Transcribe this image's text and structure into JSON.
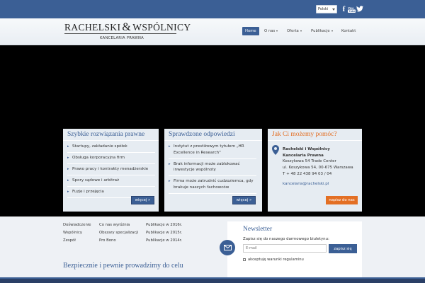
{
  "topbar": {
    "language": "Polski",
    "social": [
      "facebook-icon",
      "youtube-icon",
      "twitter-icon"
    ]
  },
  "header": {
    "logo_left": "RACHELSKI",
    "logo_amp": "&",
    "logo_right": "WSPÓLNICY",
    "logo_sub": "KANCELARIA PRAWNA",
    "nav": [
      {
        "label": "Home",
        "active": true
      },
      {
        "label": "O nas",
        "dropdown": true
      },
      {
        "label": "Oferta",
        "dropdown": true
      },
      {
        "label": "Publikacje",
        "dropdown": true
      },
      {
        "label": "Kontakt"
      }
    ]
  },
  "boxes": {
    "b1": {
      "title": "Szybkie rozwiązania prawne",
      "items": [
        "Startupy, zakładanie spółek",
        "Obsługa korporacyjna firm",
        "Prawo pracy i kontrakty menadżerskie",
        "Spory sądowe i arbitraż",
        "Fuzje i przejęcia"
      ],
      "more": "więcej »"
    },
    "b2": {
      "title": "Sprawdzone odpowiedzi",
      "items": [
        "Instytut z prestiżowym tytułem „HR Excellence in Research\"",
        "Brak informacji może zablokować inwestycje wspólnoty",
        "Firma może zatrudnić cudzoziemca, gdy brakuje naszych fachowców"
      ],
      "more": "więcej »"
    },
    "b3": {
      "title": "Jak Ci możemy pomóc?",
      "name1": "Rachelski i Wspólnicy",
      "name2": "Kancelaria Prawna",
      "addr1": "Koszykowa 54 Trade Center",
      "addr2": "ul. Koszykowa 54, 00-675 Warszawa",
      "phone": "T + 48 22 438 94 03 / 04",
      "email": "kancelaria@rachelski.pl",
      "button": "napisz do nas"
    }
  },
  "footer": {
    "col1": [
      "Doświadczenie",
      "Wspólnicy",
      "Zespół"
    ],
    "col2": [
      "Co nas wyróżnia",
      "Obszary specjalizacji",
      "Pro Bono"
    ],
    "col3": [
      "Publikacje w 2016r.",
      "Publikacje w 2015r.",
      "Publikacje w 2014r."
    ],
    "tagline": "Bezpiecznie i pewnie prowadzimy do celu"
  },
  "newsletter": {
    "title": "Newsletter",
    "desc": "Zapisz się do naszego darmowego biuletynu:",
    "placeholder": "E-mail",
    "button": "zapisz się",
    "checkbox": "akceptuję warunki regulaminu"
  },
  "colors": {
    "primary": "#3b5f95",
    "accent": "#e36f24",
    "hero": "#000000"
  }
}
